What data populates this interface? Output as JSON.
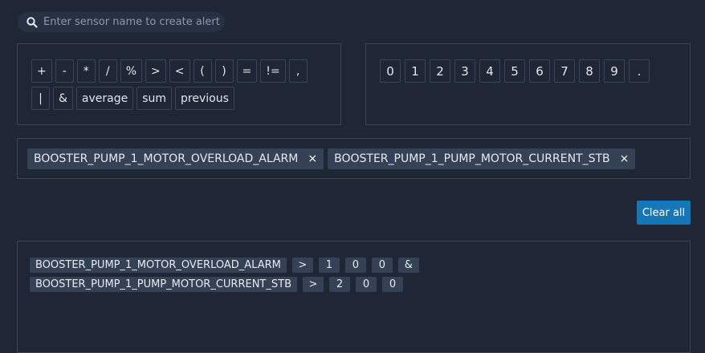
{
  "search": {
    "placeholder": "Enter sensor name to create alert"
  },
  "operators": {
    "row1": [
      "+",
      "-",
      "*",
      "/",
      "%",
      ">",
      "<",
      "(",
      ")",
      "=",
      "!=",
      ","
    ],
    "row2": [
      "|",
      "&",
      "average",
      "sum",
      "previous"
    ]
  },
  "numbers": [
    "0",
    "1",
    "2",
    "3",
    "4",
    "5",
    "6",
    "7",
    "8",
    "9",
    "."
  ],
  "selected_sensors": [
    {
      "label": "BOOSTER_PUMP_1_MOTOR_OVERLOAD_ALARM",
      "close": "×"
    },
    {
      "label": "BOOSTER_PUMP_1_PUMP_MOTOR_CURRENT_STB",
      "close": "×"
    }
  ],
  "clear_all_label": "Clear all",
  "expression": {
    "line1": [
      "BOOSTER_PUMP_1_MOTOR_OVERLOAD_ALARM",
      ">",
      "1",
      "0",
      "0",
      "&"
    ],
    "line2": [
      "BOOSTER_PUMP_1_PUMP_MOTOR_CURRENT_STB",
      ">",
      "2",
      "0",
      "0"
    ]
  },
  "colors": {
    "background": "#1f2737",
    "accent": "#1577b8",
    "chip": "#354155",
    "border": "#3a4558"
  }
}
